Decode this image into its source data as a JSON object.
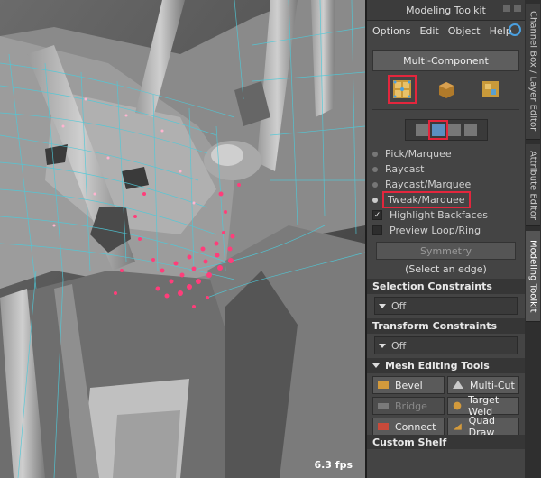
{
  "viewport": {
    "fps": "6.3 fps"
  },
  "panel": {
    "title": "Modeling Toolkit",
    "menu": [
      "Options",
      "Edit",
      "Object",
      "Help"
    ],
    "multi_component_label": "Multi-Component",
    "selection_modes": [
      {
        "label": "Pick/Marquee",
        "selected": false
      },
      {
        "label": "Raycast",
        "selected": false
      },
      {
        "label": "Raycast/Marquee",
        "selected": false
      },
      {
        "label": "Tweak/Marquee",
        "selected": true
      }
    ],
    "checkboxes": [
      {
        "label": "Highlight Backfaces",
        "checked": true
      },
      {
        "label": "Preview Loop/Ring",
        "checked": false
      }
    ],
    "symmetry_label": "Symmetry",
    "hint": "(Select an edge)",
    "selection_constraints": {
      "title": "Selection Constraints",
      "value": "Off"
    },
    "transform_constraints": {
      "title": "Transform Constraints",
      "value": "Off"
    },
    "mesh_tools_title": "Mesh Editing Tools",
    "mesh_tools": [
      {
        "label": "Bevel",
        "icon": "bevel-icon",
        "enabled": true
      },
      {
        "label": "Multi-Cut",
        "icon": "multi-cut-icon",
        "enabled": true
      },
      {
        "label": "Bridge",
        "icon": "bridge-icon",
        "enabled": false
      },
      {
        "label": "Target Weld",
        "icon": "target-weld-icon",
        "enabled": true
      },
      {
        "label": "Connect",
        "icon": "connect-icon",
        "enabled": true
      },
      {
        "label": "Quad Draw",
        "icon": "quad-draw-icon",
        "enabled": true
      }
    ],
    "custom_shelf": "Custom Shelf"
  },
  "side_tabs": [
    "Channel Box / Layer Editor",
    "Attribute Editor",
    "Modeling Toolkit"
  ],
  "colors": {
    "highlight": "#e3263d",
    "wire": "#4fc9d8",
    "vertex": "#ff3d7a",
    "accent": "#4aa0e0"
  }
}
